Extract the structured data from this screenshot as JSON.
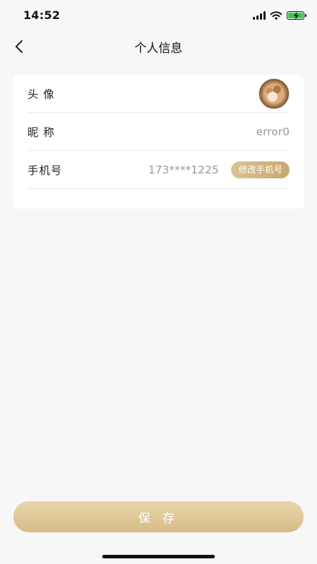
{
  "status_bar": {
    "time": "14:52",
    "icons": [
      "signal-icon",
      "wifi-icon",
      "battery-icon"
    ],
    "battery_color": "#3cc94c"
  },
  "nav": {
    "back_icon": "chevron-left-icon",
    "title": "个人信息"
  },
  "profile": {
    "avatar_label": "头 像",
    "nickname_label": "昵 称",
    "nickname_value": "error0",
    "phone_label": "手机号",
    "phone_value": "173****1225",
    "change_phone_label": "修改手机号"
  },
  "footer": {
    "save_label": "保 存"
  },
  "colors": {
    "accent_gold": "#d6bc86",
    "background": "#f7f7f7",
    "card": "#ffffff",
    "muted_text": "#9a9a9a"
  }
}
